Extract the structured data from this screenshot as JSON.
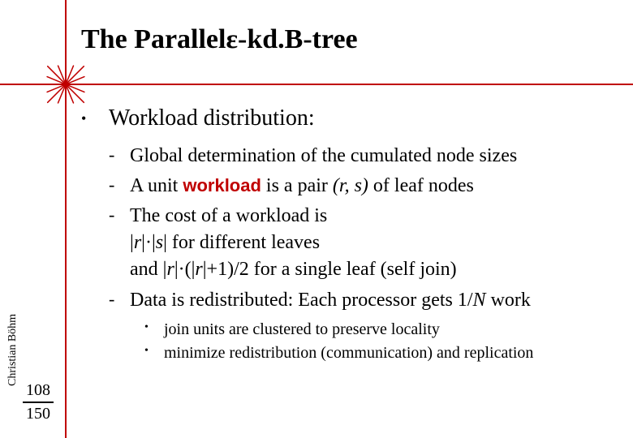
{
  "title": {
    "pre": "The Parallel ",
    "eps": "ε",
    "post": "-kd.B-tree"
  },
  "main_bullet": "Workload distribution:",
  "sub": {
    "s1": "Global determination of the cumulated node sizes",
    "s2a": "A unit ",
    "s2hl": "workload",
    "s2b": " is a pair ",
    "s2pair": "(r, s)",
    "s2c": " of leaf nodes",
    "s3a": "The cost of a workload is",
    "s3b_pre": "|",
    "s3b_r": "r",
    "s3b_mid1": "|·|",
    "s3b_s": "s",
    "s3b_mid2": "| for different leaves",
    "s3c_pre": "and |",
    "s3c_r1": "r",
    "s3c_mid": "|·(|",
    "s3c_r2": "r",
    "s3c_post": "|+1)/2 for a single leaf (self join)",
    "s4a": "Data is redistributed: Each processor gets 1/",
    "s4n": "N",
    "s4b": " work"
  },
  "subsub": {
    "a": "join units are clustered to preserve locality",
    "b": "minimize redistribution (communication) and replication"
  },
  "author": "Christian Böhm",
  "page": {
    "current": "108",
    "total": "150"
  }
}
